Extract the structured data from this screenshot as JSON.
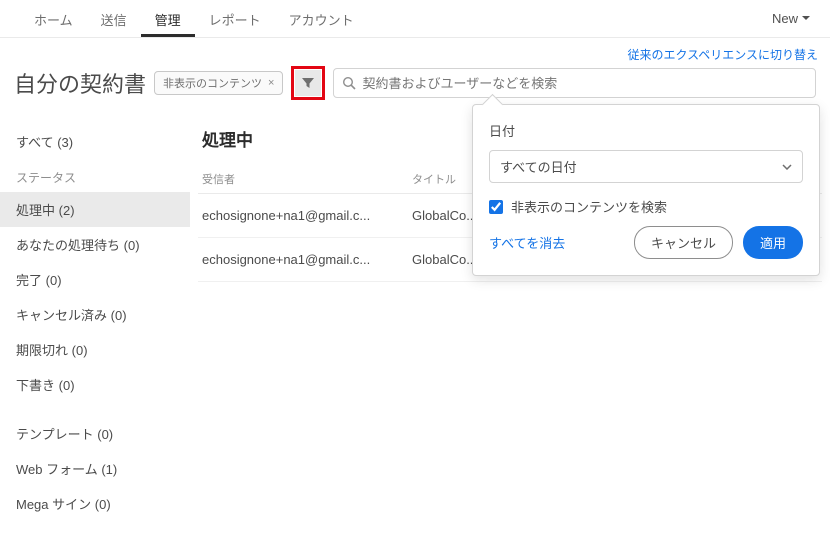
{
  "topnav": {
    "items": [
      "ホーム",
      "送信",
      "管理",
      "レポート",
      "アカウント"
    ],
    "active_index": 2,
    "new_label": "New"
  },
  "switch_experience": "従来のエクスペリエンスに切り替え",
  "page_title": "自分の契約書",
  "filter_chip": {
    "label": "非表示のコンテンツ",
    "close": "×"
  },
  "search": {
    "placeholder": "契約書およびユーザーなどを検索"
  },
  "sidebar": {
    "all": {
      "label": "すべて",
      "count": "(3)"
    },
    "status_label": "ステータス",
    "items": [
      {
        "label": "処理中",
        "count": "(2)",
        "selected": true
      },
      {
        "label": "あなたの処理待ち",
        "count": "(0)"
      },
      {
        "label": "完了",
        "count": "(0)"
      },
      {
        "label": "キャンセル済み",
        "count": "(0)"
      },
      {
        "label": "期限切れ",
        "count": "(0)"
      },
      {
        "label": "下書き",
        "count": "(0)"
      }
    ],
    "group2": [
      {
        "label": "テンプレート",
        "count": "(0)"
      },
      {
        "label": "Web フォーム",
        "count": "(1)"
      },
      {
        "label": "Mega サイン",
        "count": "(0)"
      }
    ]
  },
  "main": {
    "section_title": "処理中",
    "columns": {
      "recipient": "受信者",
      "title": "タイトル"
    },
    "rows": [
      {
        "recipient": "echosignone+na1@gmail.c...",
        "title": "GlobalCo..."
      },
      {
        "recipient": "echosignone+na1@gmail.c...",
        "title": "GlobalCo..."
      }
    ]
  },
  "popover": {
    "date_label": "日付",
    "select_value": "すべての日付",
    "checkbox_label": "非表示のコンテンツを検索",
    "checkbox_checked": true,
    "clear_label": "すべてを消去",
    "cancel_label": "キャンセル",
    "apply_label": "適用"
  }
}
